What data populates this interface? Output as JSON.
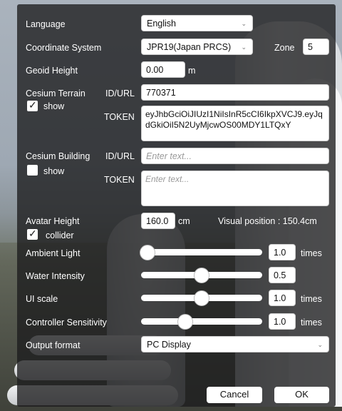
{
  "language": {
    "label": "Language",
    "value": "English"
  },
  "coordinate_system": {
    "label": "Coordinate System",
    "value": "JPR19(Japan PRCS)",
    "zone_label": "Zone",
    "zone_value": "5"
  },
  "geoid": {
    "label": "Geoid Height",
    "value": "0.00",
    "unit": "m"
  },
  "cesium_terrain": {
    "label": "Cesium Terrain",
    "id_label": "ID/URL",
    "id_value": "770371",
    "show_label": "show",
    "show_checked": true,
    "token_label": "TOKEN",
    "token_value": "eyJhbGciOiJIUzI1NiIsInR5cCI6IkpXVCJ9.eyJqdGkiOiI5N2UyMjcwOS00MDY1LTQxY"
  },
  "cesium_building": {
    "label": "Cesium Building",
    "id_label": "ID/URL",
    "id_placeholder": "Enter text...",
    "show_label": "show",
    "show_checked": false,
    "token_label": "TOKEN",
    "token_placeholder": "Enter text..."
  },
  "avatar": {
    "label": "Avatar Height",
    "value": "160.0",
    "unit": "cm",
    "visual_position": "Visual position : 150.4cm",
    "collider_label": "collider",
    "collider_checked": true
  },
  "ambient_light": {
    "label": "Ambient Light",
    "value": "1.0",
    "unit": "times",
    "level": 0.0
  },
  "water_intensity": {
    "label": "Water Intensity",
    "value": "0.5",
    "level": 0.5
  },
  "ui_scale": {
    "label": "UI scale",
    "value": "1.0",
    "unit": "times",
    "level": 0.5
  },
  "controller_sensitivity": {
    "label": "Controller Sensitivity",
    "value": "1.0",
    "unit": "times",
    "level": 0.35
  },
  "output_format": {
    "label": "Output format",
    "value": "PC Display"
  },
  "buttons": {
    "cancel": "Cancel",
    "ok": "OK"
  },
  "icons": {
    "dropdown": "chevron-down-icon",
    "check": "checkmark-icon"
  }
}
